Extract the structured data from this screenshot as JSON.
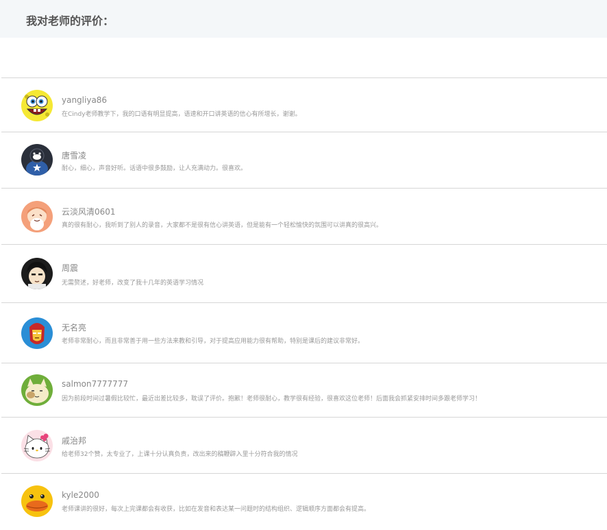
{
  "header": {
    "title": "我对老师的评价："
  },
  "reviews": [
    {
      "username": "yangliya86",
      "comment": "在Cindy老师教学下，我的口语有明显提高，语速和开口讲英语的信心有所增长，谢谢。",
      "avatar_icon": "spongebob-avatar-icon"
    },
    {
      "username": "唐雪凌",
      "comment": "耐心，细心，声音好听。话语中很多鼓励，让人充满动力。很喜欢。",
      "avatar_icon": "penguin-star-avatar-icon"
    },
    {
      "username": "云淡风清0601",
      "comment": "真的很有耐心，我听到了别人的录音，大家都不是很有信心讲英语，但是能有一个轻松愉快的氛围可以讲真的很高兴。",
      "avatar_icon": "anime-girl-avatar-icon"
    },
    {
      "username": "周震",
      "comment": "无需赘述，好老师，改变了我十几年的英语学习情况",
      "avatar_icon": "anime-boy-avatar-icon"
    },
    {
      "username": "无名亮",
      "comment": "老师非常耐心，而且非常善于用一些方法来教和引导，对于提高应用能力很有帮助，特别是课后的建议非常好。",
      "avatar_icon": "ironman-avatar-icon"
    },
    {
      "username": "salmon7777777",
      "comment": "因为前段时间过暑假比较忙，最近出差比较多，耽误了评价。抱歉！老师很耐心，教学很有经验，很喜欢这位老师！后面我会抓紧安排时间多跟老师学习！",
      "avatar_icon": "cat-avatar-icon"
    },
    {
      "username": "戚治邦",
      "comment": "给老师32个赞，太专业了，上课十分认真负责，改出来的稿鞭辟入里十分符合我的情况",
      "avatar_icon": "hello-kitty-avatar-icon"
    },
    {
      "username": "kyle2000",
      "comment": "老师课讲的很好，每次上完课都会有收获，比如在发音和表达某一问题时的结构组织、逻辑顺序方面都会有提高。",
      "avatar_icon": "duck-avatar-icon"
    }
  ]
}
